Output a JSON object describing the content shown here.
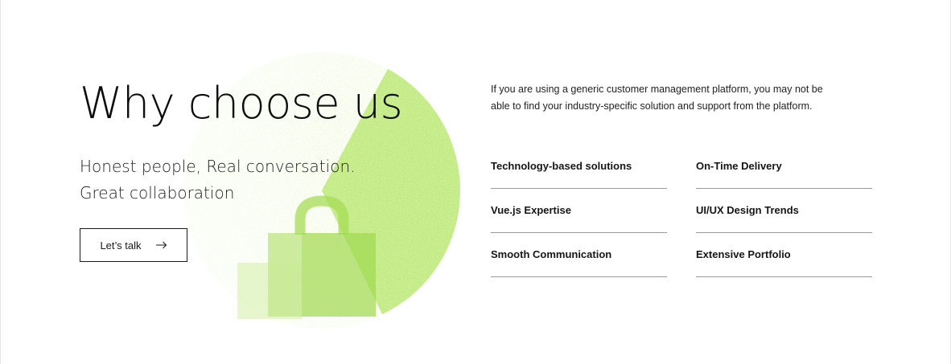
{
  "hero": {
    "title": "Why choose us",
    "subtitle_line1": "Honest people, Real conversation.",
    "subtitle_line2": "Great collaboration",
    "cta_label": "Let’s talk",
    "cta_icon": "arrow-right-icon",
    "art_icon": "shopping-bag-icon",
    "accent_color": "#a8e05a"
  },
  "intro": {
    "text": "If you are using a generic customer management platform, you may not be able to find your industry-specific solution and support from the platform."
  },
  "features": [
    {
      "label": "Technology-based solutions"
    },
    {
      "label": "On-Time Delivery"
    },
    {
      "label": "Vue.js Expertise"
    },
    {
      "label": "UI/UX Design Trends"
    },
    {
      "label": "Smooth Communication"
    },
    {
      "label": "Extensive Portfolio"
    }
  ]
}
